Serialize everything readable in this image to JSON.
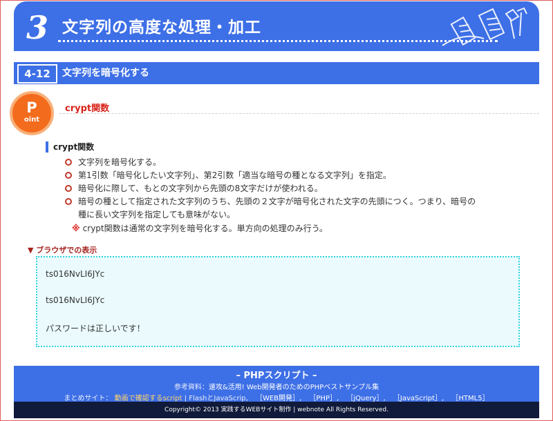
{
  "chapter": {
    "number": "3",
    "title": "文字列の高度な処理・加工"
  },
  "section": {
    "number": "4-12",
    "title": "文字列を暗号化する"
  },
  "point": {
    "badge_letter": "P",
    "badge_sub": "oint",
    "title": "crypt関数"
  },
  "content": {
    "heading": "crypt関数",
    "bullets": [
      "文字列を暗号化する。",
      "第1引数「暗号化したい文字列」、第2引数「適当な暗号の種となる文字列」を指定。",
      "暗号化に際して、もとの文字列から先頭の8文字だけが使われる。",
      "暗号の種として指定された文字列のうち、先頭の２文字が暗号化された文字の先頭につく。つまり、暗号の",
      "種に長い文字列を指定しても意味がない。"
    ],
    "note_mark": "※",
    "note": "crypt関数は通常の文字列を暗号化する。単方向の処理のみ行う。"
  },
  "browser": {
    "label": "▼ ブラウザでの表示",
    "lines": [
      "ts016NvLI6JYc",
      "ts016NvLI6JYc",
      "パスワードは正しいです！"
    ]
  },
  "footer": {
    "heading": "– PHPスクリプト –",
    "ref_label": "参考資料：",
    "ref_link": "速攻&活用! Web開発者のためのPHPベストサンプル集",
    "sites_label": "まとめサイト：",
    "sites_highlight": "動画で確認するscript",
    "sites_mid": "| FlashとJavaScrip",
    "links": [
      "［WEB開発］",
      "［PHP］",
      "［jQuery］",
      "［JavaScript］",
      "［HTML5］"
    ],
    "copyright": "Copyright© 2013 実践するWEBサイト制作 | webnote All Rights Reserved."
  },
  "colors": {
    "header_blue": "#3d6fe6",
    "point_orange": "#f36b1c",
    "accent_red": "#d9241b",
    "browser_bg": "#eafafd",
    "browser_border": "#30d4e0",
    "footer_dark": "#101a3a"
  }
}
